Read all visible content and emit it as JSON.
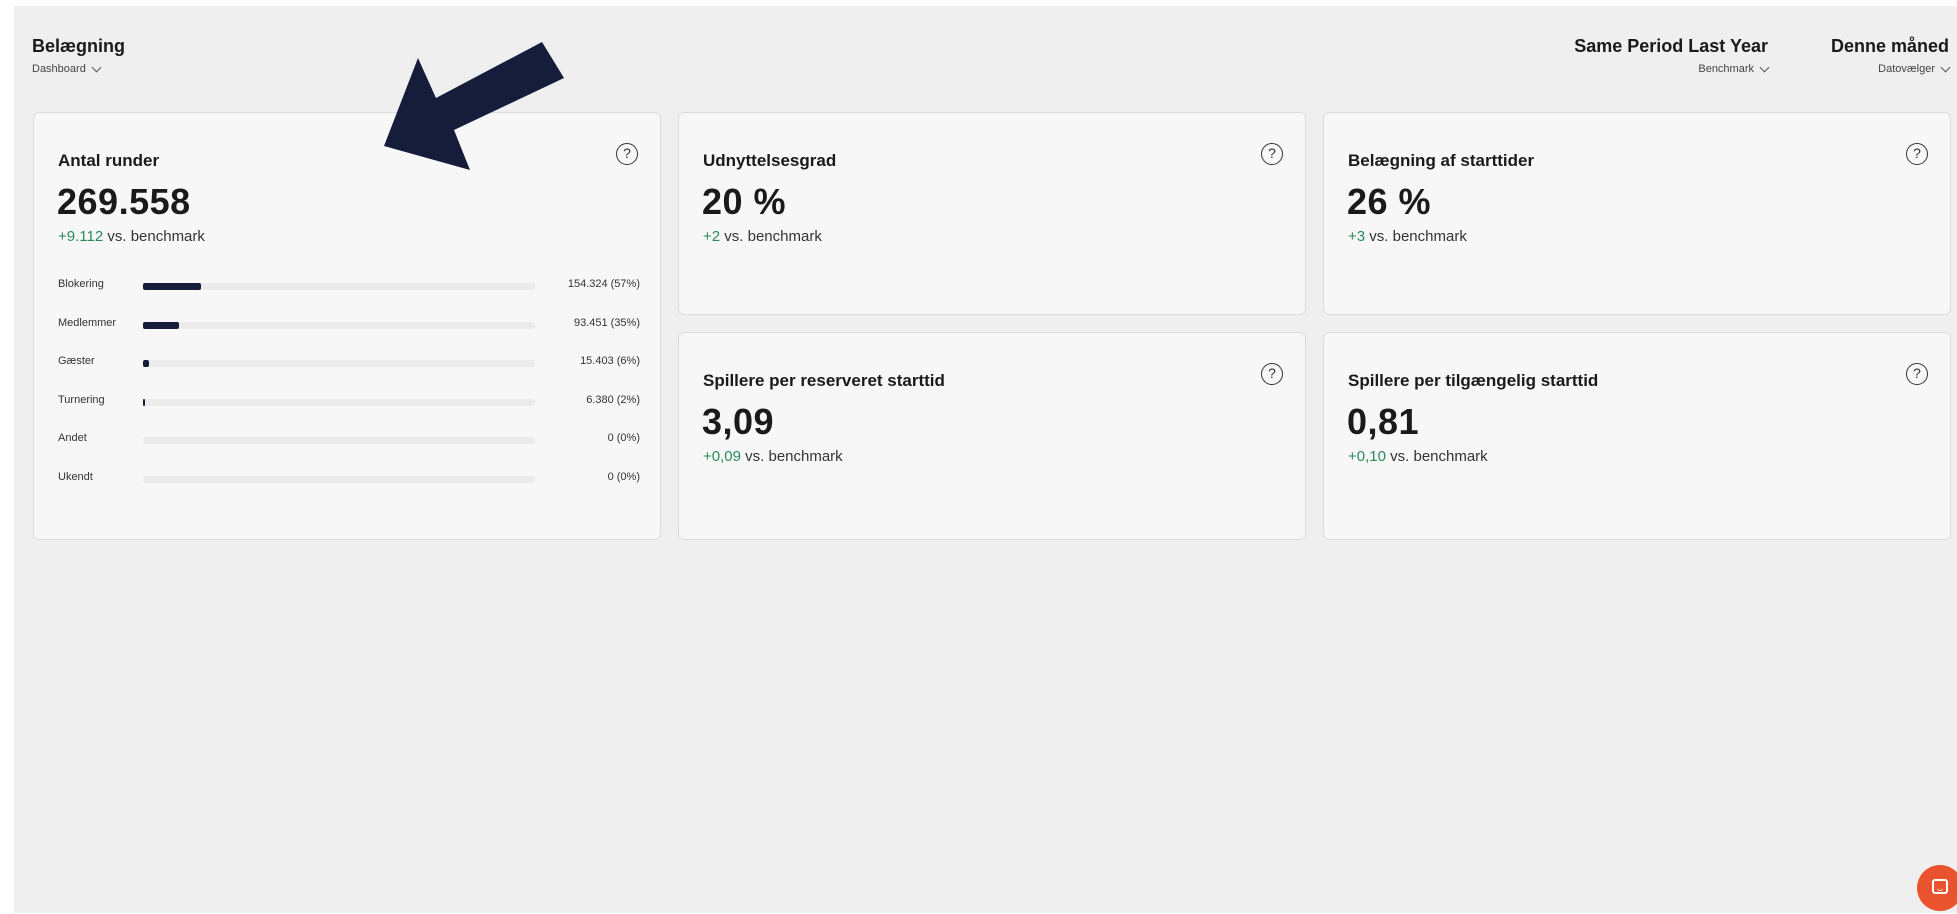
{
  "header": {
    "title": "Belægning",
    "dashboard_label": "Dashboard",
    "benchmark_value": "Same Period Last Year",
    "benchmark_label": "Benchmark",
    "date_value": "Denne måned",
    "date_label": "Datovælger"
  },
  "cards": {
    "rounds": {
      "title": "Antal runder",
      "value": "269.558",
      "delta": "+9.112",
      "delta_suffix": "vs. benchmark",
      "help": "?",
      "breakdown": [
        {
          "label": "Blokering",
          "value": "154.324 (57%)",
          "share": 0.57
        },
        {
          "label": "Medlemmer",
          "value": "93.451 (35%)",
          "share": 0.35
        },
        {
          "label": "Gæster",
          "value": "15.403 (6%)",
          "share": 0.06
        },
        {
          "label": "Turnering",
          "value": "6.380 (2%)",
          "share": 0.02
        },
        {
          "label": "Andet",
          "value": "0 (0%)",
          "share": 0
        },
        {
          "label": "Ukendt",
          "value": "0 (0%)",
          "share": 0
        }
      ]
    },
    "utilization": {
      "title": "Udnyttelsesgrad",
      "value": "20 %",
      "delta": "+2",
      "delta_suffix": "vs. benchmark",
      "help": "?"
    },
    "teetime_occupancy": {
      "title": "Belægning af starttider",
      "value": "26 %",
      "delta": "+3",
      "delta_suffix": "vs. benchmark",
      "help": "?"
    },
    "players_reserved": {
      "title": "Spillere per reserveret starttid",
      "value": "3,09",
      "delta": "+0,09",
      "delta_suffix": "vs. benchmark",
      "help": "?"
    },
    "players_available": {
      "title": "Spillere per tilgængelig starttid",
      "value": "0,81",
      "delta": "+0,10",
      "delta_suffix": "vs. benchmark",
      "help": "?"
    }
  },
  "colors": {
    "positive": "#2a8a5a",
    "bar_fill": "#151d3b",
    "arrow": "#151d3b",
    "chat_button": "#e9542f"
  },
  "icons": {
    "arrow": "arrow-annotation-icon",
    "help": "question-circle-icon",
    "chat": "chat-bubble-icon"
  }
}
